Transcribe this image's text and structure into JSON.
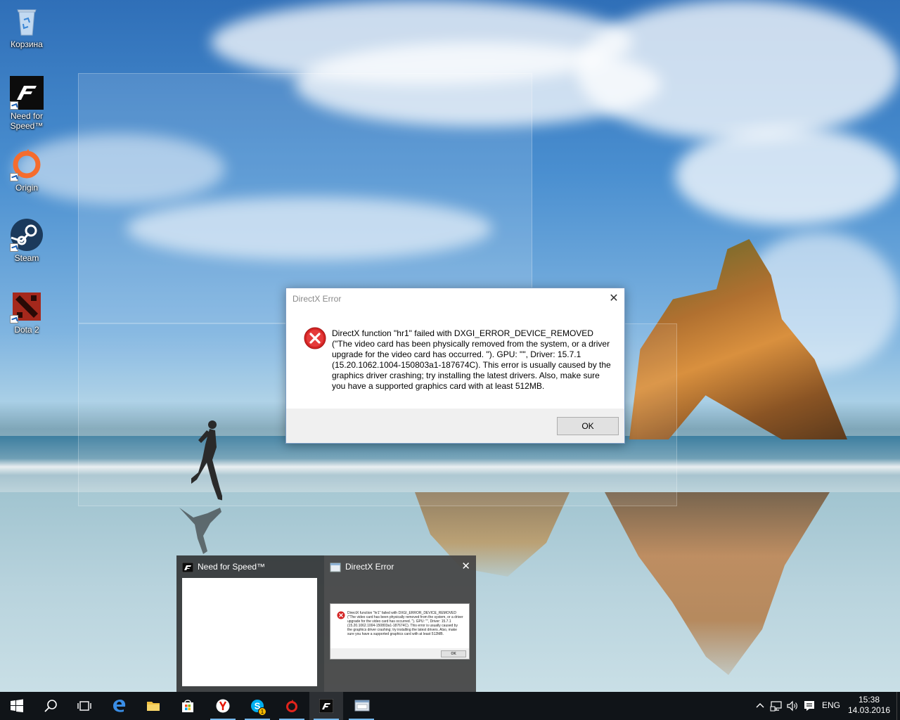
{
  "desktop_icons": [
    {
      "label": "Корзина",
      "icon": "recycle-bin-icon"
    },
    {
      "label": "Need for Speed™",
      "icon": "need-for-speed-icon"
    },
    {
      "label": "Origin",
      "icon": "origin-icon"
    },
    {
      "label": "Steam",
      "icon": "steam-icon"
    },
    {
      "label": "Dota 2",
      "icon": "dota2-icon"
    }
  ],
  "dialog": {
    "title": "DirectX Error",
    "message": "DirectX function \"hr1\" failed with DXGI_ERROR_DEVICE_REMOVED (\"The video card has been physically removed from the system, or a driver upgrade for the video card has occurred. \"). GPU: \"\", Driver: 15.7.1 (15.20.1062.1004-150803a1-187674C). This error is usually caused by the graphics driver crashing; try installing the latest drivers. Also, make sure you have a supported graphics card with at least 512MB.",
    "ok_label": "OK",
    "close_glyph": "✕"
  },
  "preview": {
    "items": [
      {
        "title": "Need for Speed™"
      },
      {
        "title": "DirectX Error",
        "close_glyph": "✕"
      }
    ],
    "mini_message": "DirectX function \"hr1\" failed with DXGI_ERROR_DEVICE_REMOVED (\"The video card has been physically removed from the system, or a driver upgrade for the video card has occurred. \"). GPU: \"\", Driver: 15.7.1 (15.20.1062.1004-150803a1-187674C). This error is usually caused by the graphics driver crashing; try installing the latest drivers. Also, make sure you have a supported graphics card with at least 512MB.",
    "mini_ok": "OK"
  },
  "taskbar": {
    "buttons": [
      {
        "icon": "windows-start-icon"
      },
      {
        "icon": "search-icon"
      },
      {
        "icon": "task-view-icon"
      },
      {
        "icon": "edge-icon"
      },
      {
        "icon": "file-explorer-icon"
      },
      {
        "icon": "store-icon"
      },
      {
        "icon": "yandex-browser-icon"
      },
      {
        "icon": "skype-icon",
        "badge": "1"
      },
      {
        "icon": "origin-icon"
      },
      {
        "icon": "need-for-speed-icon"
      },
      {
        "icon": "app-window-icon"
      }
    ],
    "tray": {
      "language": "ENG",
      "time": "15:38",
      "date": "14.03.2016"
    }
  },
  "colors": {
    "taskbar": "#101418",
    "accent": "#76b9ed",
    "error_red": "#d42424",
    "dialog_footer": "#f0f0f0"
  }
}
